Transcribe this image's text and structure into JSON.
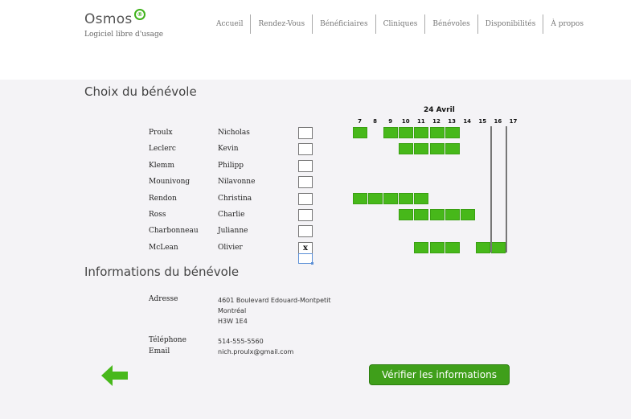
{
  "app": {
    "name": "Osmos",
    "tagline": "Logiciel libre d'usage",
    "logo_symbol": "®",
    "accent": "#3fb21a"
  },
  "nav": {
    "items": [
      "Accueil",
      "Rendez-Vous",
      "Bénéficiaires",
      "Cliniques",
      "Bénévoles",
      "Disponibilités",
      "À propos"
    ]
  },
  "volunteer_choice": {
    "title": "Choix du bénévole",
    "calendar_date": "24 Avril",
    "hours": [
      "7",
      "8",
      "9",
      "10",
      "11",
      "12",
      "13",
      "14",
      "15",
      "16",
      "17"
    ],
    "volunteers": [
      {
        "last": "Proulx",
        "first": "Nicholas",
        "checked": "",
        "available_hours": [
          7,
          9,
          10,
          11,
          12,
          13
        ]
      },
      {
        "last": "Leclerc",
        "first": "Kevin",
        "checked": "",
        "available_hours": [
          10,
          11,
          12,
          13
        ]
      },
      {
        "last": "Klemm",
        "first": "Philipp",
        "checked": "",
        "available_hours": []
      },
      {
        "last": "Mounivong",
        "first": "Nilavonne",
        "checked": "",
        "available_hours": []
      },
      {
        "last": "Rendon",
        "first": "Christina",
        "checked": "",
        "available_hours": [
          7,
          8,
          9,
          10,
          11
        ]
      },
      {
        "last": "Ross",
        "first": "Charlie",
        "checked": "",
        "available_hours": [
          10,
          11,
          12,
          13,
          14
        ]
      },
      {
        "last": "Charbonneau",
        "first": "Julianne",
        "checked": "",
        "available_hours": []
      },
      {
        "last": "McLean",
        "first": "Olivier",
        "checked": "x",
        "available_hours": [
          11,
          12,
          13,
          15,
          16
        ]
      }
    ],
    "appointment_hour_markers": [
      16,
      17
    ]
  },
  "volunteer_info": {
    "title": "Informations du bénévole",
    "address_label": "Adresse",
    "address_line1": "4601 Boulevard Edouard-Montpetit",
    "address_line2": "Montréal",
    "address_line3": "H3W 1E4",
    "phone_label": "Téléphone",
    "phone": "514-555-5560",
    "email_label": "Email",
    "email": "nich.proulx@gmail.com"
  },
  "actions": {
    "back_icon": "arrow-left-icon",
    "verify_label": "Vérifier les informations",
    "button_color": "#3f9f1a"
  }
}
